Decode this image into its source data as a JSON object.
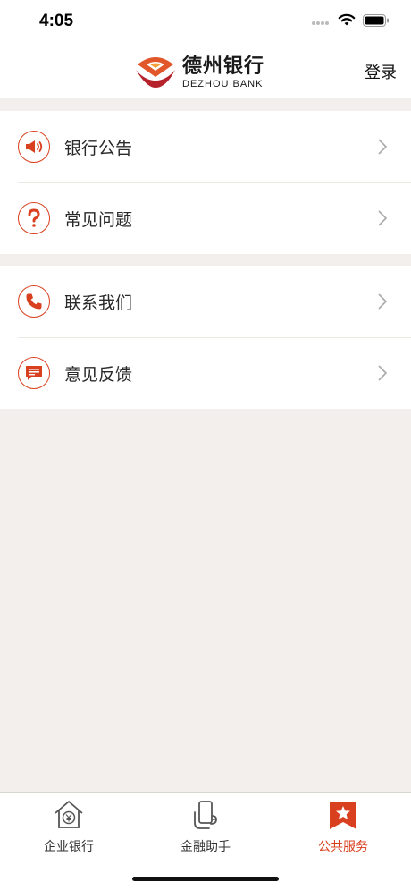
{
  "status_bar": {
    "time": "4:05"
  },
  "header": {
    "brand_name": "德州银行",
    "brand_sub": "DEZHOU BANK",
    "login_label": "登录"
  },
  "groups": [
    {
      "items": [
        {
          "label": "银行公告",
          "icon": "megaphone-icon"
        },
        {
          "label": "常见问题",
          "icon": "question-icon"
        }
      ]
    },
    {
      "items": [
        {
          "label": "联系我们",
          "icon": "phone-icon"
        },
        {
          "label": "意见反馈",
          "icon": "feedback-icon"
        }
      ]
    }
  ],
  "tabs": [
    {
      "label": "企业银行",
      "icon": "house-yen-icon",
      "active": false
    },
    {
      "label": "金融助手",
      "icon": "phone-hand-icon",
      "active": false
    },
    {
      "label": "公共服务",
      "icon": "star-bookmark-icon",
      "active": true
    }
  ],
  "colors": {
    "accent": "#d9401f",
    "background": "#f2efec",
    "text": "#2a2a2a"
  }
}
